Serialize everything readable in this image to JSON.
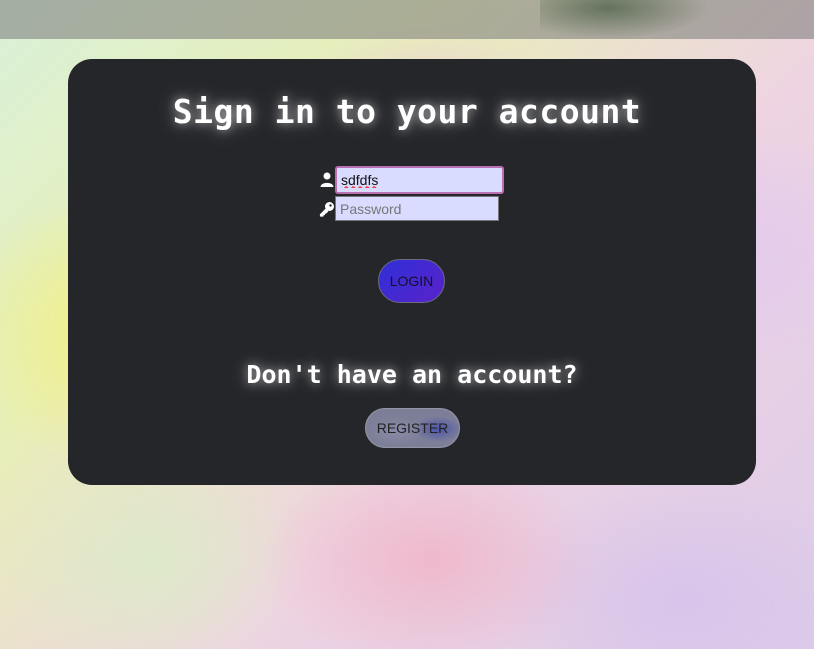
{
  "title": "Sign in to your account",
  "username": {
    "value": "sdfdfs",
    "icon": "user-icon"
  },
  "password": {
    "placeholder": "Password",
    "icon": "key-icon"
  },
  "login_label": "LOGIN",
  "register_prompt": "Don't have an account?",
  "register_label": "REGISTER",
  "colors": {
    "card": "#25262a",
    "input_bg": "#d9dcff",
    "login_accent": "#3a2ed5",
    "focus_border": "#b96fb0"
  }
}
